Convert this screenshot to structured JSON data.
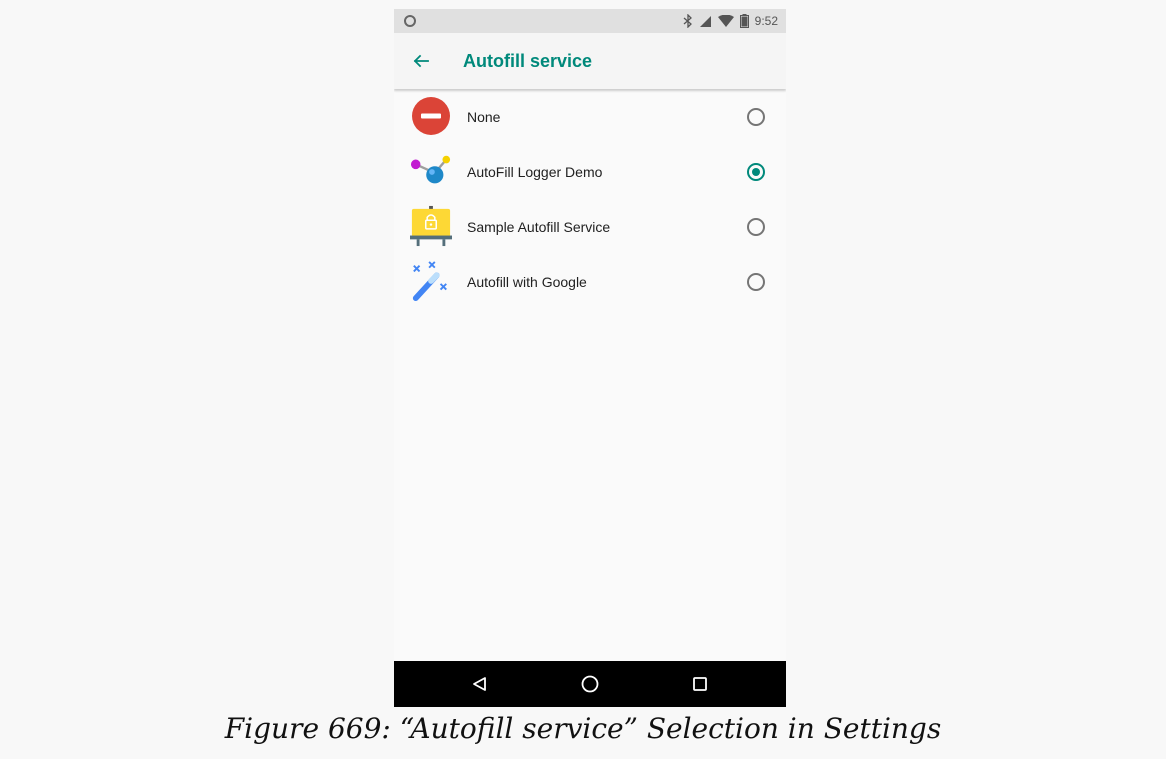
{
  "status_bar": {
    "time": "9:52",
    "icons": [
      "circle-notification-icon",
      "bluetooth-icon",
      "cell-signal-icon",
      "wifi-icon",
      "battery-icon"
    ]
  },
  "app_bar": {
    "title": "Autofill service",
    "back_icon": "arrow-back-icon"
  },
  "colors": {
    "accent": "#00897b",
    "background": "#fafafa",
    "status_bar": "#e0e0e0",
    "nav_bar": "#000000"
  },
  "services": [
    {
      "label": "None",
      "icon": "no-entry-icon",
      "selected": false
    },
    {
      "label": "AutoFill Logger Demo",
      "icon": "molecule-icon",
      "selected": true
    },
    {
      "label": "Sample Autofill Service",
      "icon": "lock-easel-icon",
      "selected": false
    },
    {
      "label": "Autofill with Google",
      "icon": "magic-wand-icon",
      "selected": false
    }
  ],
  "nav_bar": {
    "icons": [
      "back-triangle-icon",
      "home-circle-icon",
      "recents-square-icon"
    ]
  },
  "caption": "Figure 669: “Autofill service” Selection in Settings"
}
